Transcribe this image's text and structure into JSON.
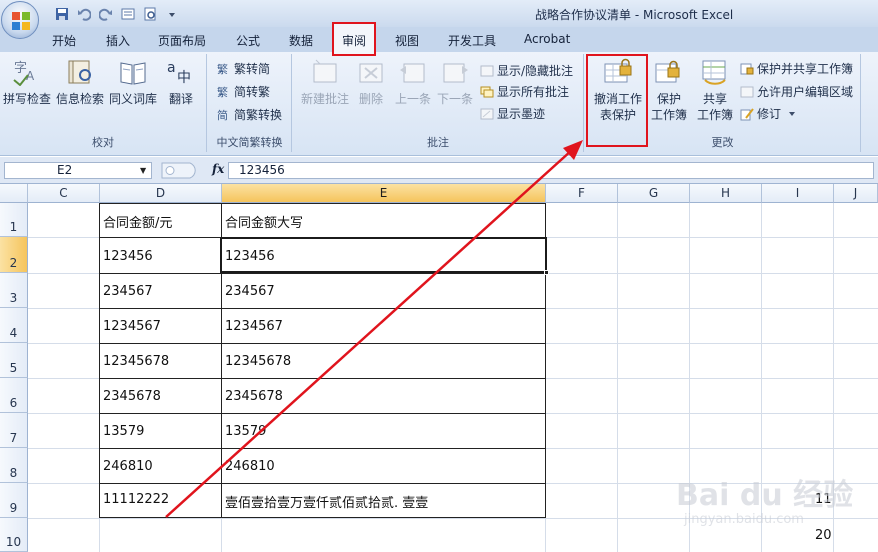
{
  "window": {
    "title": "战略合作协议清单 - Microsoft Excel",
    "qat": [
      "save-icon",
      "undo-icon",
      "redo-icon",
      "form-icon",
      "print-preview-icon",
      "customize-icon"
    ]
  },
  "tabs": [
    "开始",
    "插入",
    "页面布局",
    "公式",
    "数据",
    "审阅",
    "视图",
    "开发工具",
    "Acrobat"
  ],
  "active_tab": "审阅",
  "ribbon": {
    "proofing": {
      "label": "校对",
      "buttons": [
        "拼写检查",
        "信息检索",
        "同义词库",
        "翻译"
      ]
    },
    "chinese_conversion": {
      "label": "中文简繁转换",
      "buttons": [
        "繁转简",
        "简转繁",
        "简繁转换"
      ]
    },
    "comments": {
      "label": "批注",
      "big_buttons": [
        "新建批注",
        "删除",
        "上一条",
        "下一条"
      ],
      "small_buttons": [
        "显示/隐藏批注",
        "显示所有批注",
        "显示墨迹"
      ]
    },
    "changes": {
      "label": "更改",
      "unprotect": [
        "撤消工作",
        "表保护"
      ],
      "protect_workbook": [
        "保护",
        "工作簿"
      ],
      "share_workbook": [
        "共享",
        "工作簿"
      ],
      "small_buttons": [
        "保护并共享工作簿",
        "允许用户编辑区域",
        "修订"
      ]
    }
  },
  "formula_bar": {
    "name_box": "E2",
    "fx": "fx",
    "formula": "123456"
  },
  "grid": {
    "columns": [
      "C",
      "D",
      "E",
      "F",
      "G",
      "H",
      "I",
      "J"
    ],
    "selected_column": "E",
    "rows": [
      "1",
      "2",
      "3",
      "4",
      "5",
      "6",
      "7",
      "8",
      "9",
      "10"
    ],
    "selected_row": "2",
    "header": [
      "合同金额/元",
      "合同金额大写"
    ],
    "data": [
      [
        "123456",
        "123456"
      ],
      [
        "234567",
        "234567"
      ],
      [
        "1234567",
        "1234567"
      ],
      [
        "12345678",
        "12345678"
      ],
      [
        "2345678",
        "2345678"
      ],
      [
        "13579",
        "13579"
      ],
      [
        "246810",
        "246810"
      ],
      [
        "11112222",
        "壹佰壹拾壹万壹仟贰佰贰拾贰. 壹壹"
      ]
    ],
    "extra": {
      "i9": "11",
      "i10": "20"
    }
  },
  "watermark": {
    "brand": "Bai du 经验",
    "url": "jingyan.baidu.com"
  },
  "colors": {
    "highlight": "#e0141d",
    "ribbon": "#d7e4f4",
    "selected_header": "#f5c45c"
  }
}
